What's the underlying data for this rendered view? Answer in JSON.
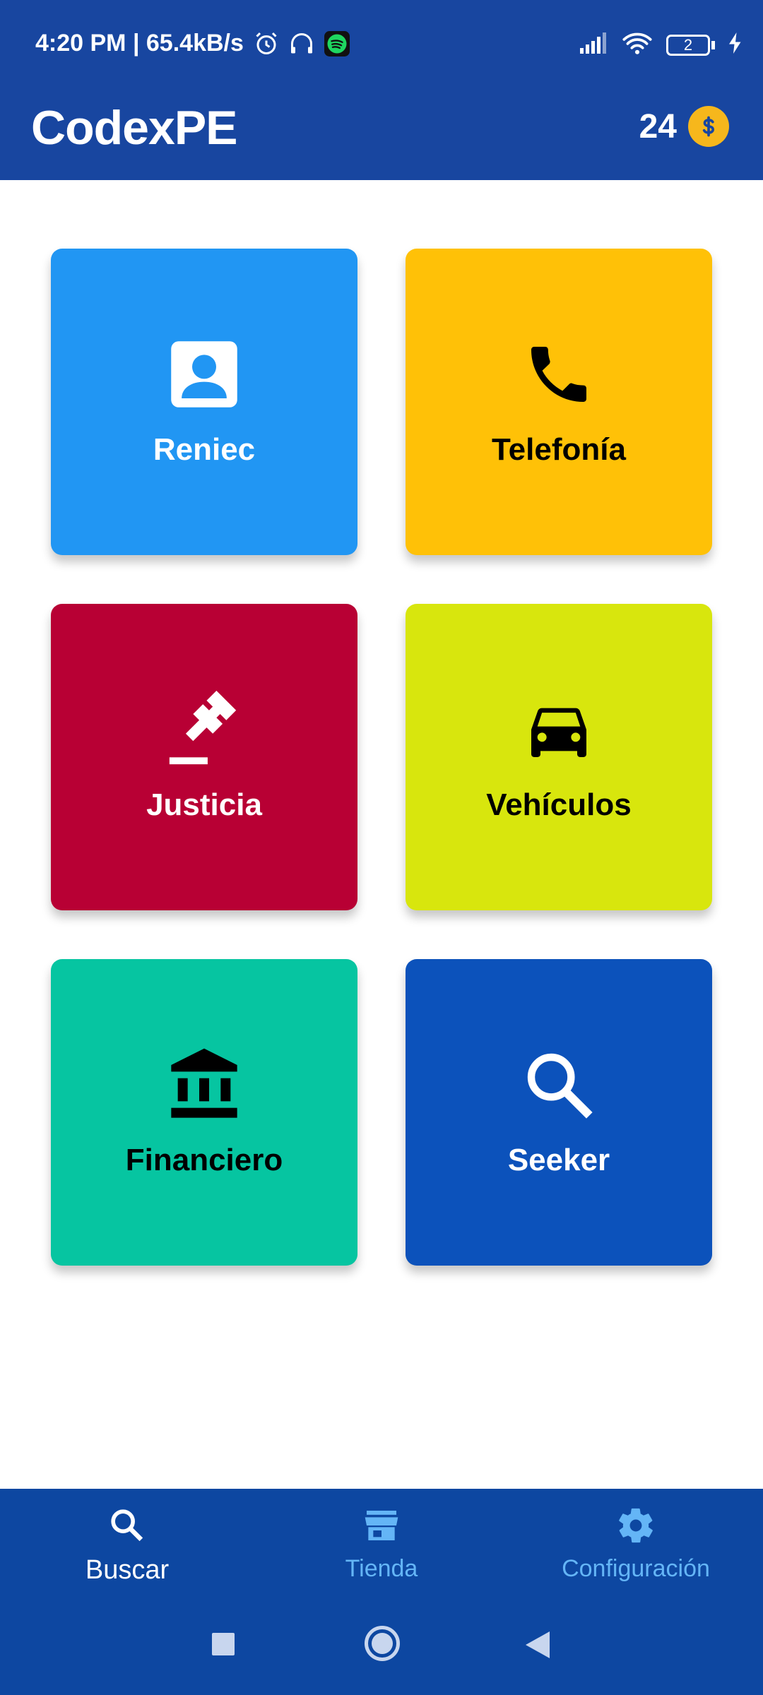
{
  "status_bar": {
    "time_speed": "4:20 PM | 65.4kB/s",
    "battery": "2",
    "icons": [
      "alarm-icon",
      "headphones-icon",
      "spotify-icon",
      "signal-icon",
      "wifi-icon",
      "battery-icon",
      "charging-icon"
    ]
  },
  "header": {
    "title": "CodexPE",
    "coins": "24"
  },
  "tiles": [
    {
      "label": "Reniec",
      "icon": "person-badge-icon",
      "color": "#2196f3",
      "text_color": "#ffffff"
    },
    {
      "label": "Telefonía",
      "icon": "phone-icon",
      "color": "#ffc107",
      "text_color": "#000000"
    },
    {
      "label": "Justicia",
      "icon": "gavel-icon",
      "color": "#b80034",
      "text_color": "#ffffff"
    },
    {
      "label": "Vehículos",
      "icon": "car-icon",
      "color": "#d8e60d",
      "text_color": "#000000"
    },
    {
      "label": "Financiero",
      "icon": "bank-icon",
      "color": "#06c5a1",
      "text_color": "#000000"
    },
    {
      "label": "Seeker",
      "icon": "search-icon",
      "color": "#0c52bb",
      "text_color": "#ffffff"
    }
  ],
  "bottom_nav": {
    "items": [
      {
        "label": "Buscar",
        "icon": "search-icon",
        "active": true
      },
      {
        "label": "Tienda",
        "icon": "store-icon",
        "active": false
      },
      {
        "label": "Configuración",
        "icon": "gear-icon",
        "active": false
      }
    ],
    "active_color": "#ffffff",
    "inactive_color": "#64b5f6"
  },
  "colors": {
    "primary": "#1846a0",
    "nav_bg": "#0d47a1",
    "coin": "#f6b71c"
  }
}
